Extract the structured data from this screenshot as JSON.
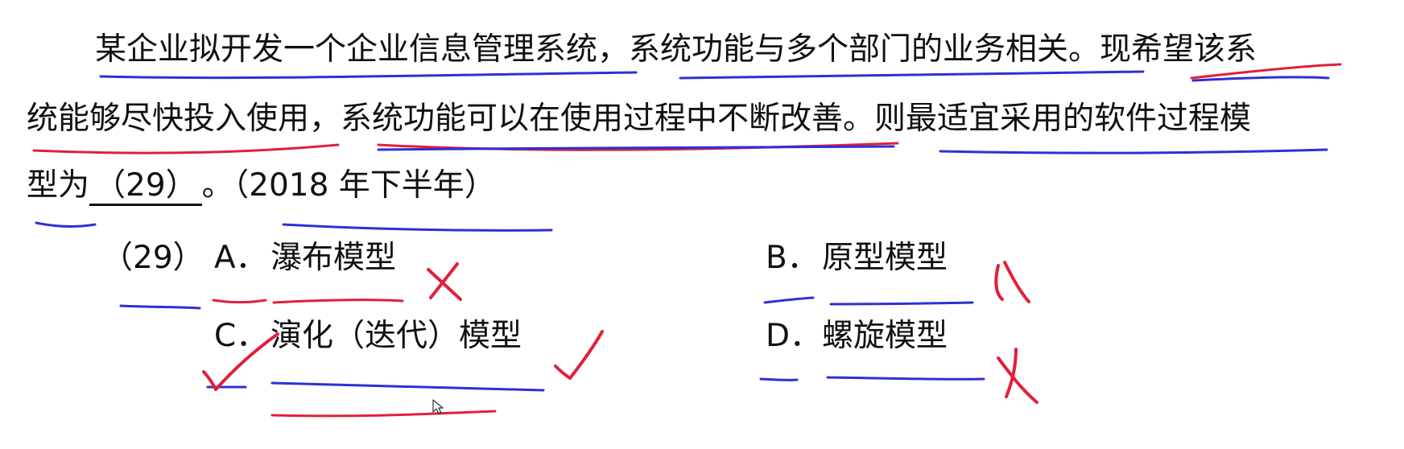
{
  "question": {
    "line1": "某企业拟开发一个企业信息管理系统，系统功能与多个部门的业务相关。现希望该系",
    "line2": "统能够尽快投入使用，系统功能可以在使用过程中不断改善。则最适宜采用的软件过程模",
    "line3_prefix": "型为",
    "blank": "（29）",
    "line3_suffix": "。（2018 年下半年）"
  },
  "question_number": "（29）",
  "options": [
    {
      "letter": "A．",
      "text": "瀑布模型",
      "mark": "cross"
    },
    {
      "letter": "B．",
      "text": "原型模型",
      "mark": "cross"
    },
    {
      "letter": "C．",
      "text": "演化（迭代）模型",
      "mark": "check"
    },
    {
      "letter": "D．",
      "text": "螺旋模型",
      "mark": "cross"
    }
  ],
  "annotation_colors": {
    "blue": "#2f2fd6",
    "red": "#e0203a"
  }
}
